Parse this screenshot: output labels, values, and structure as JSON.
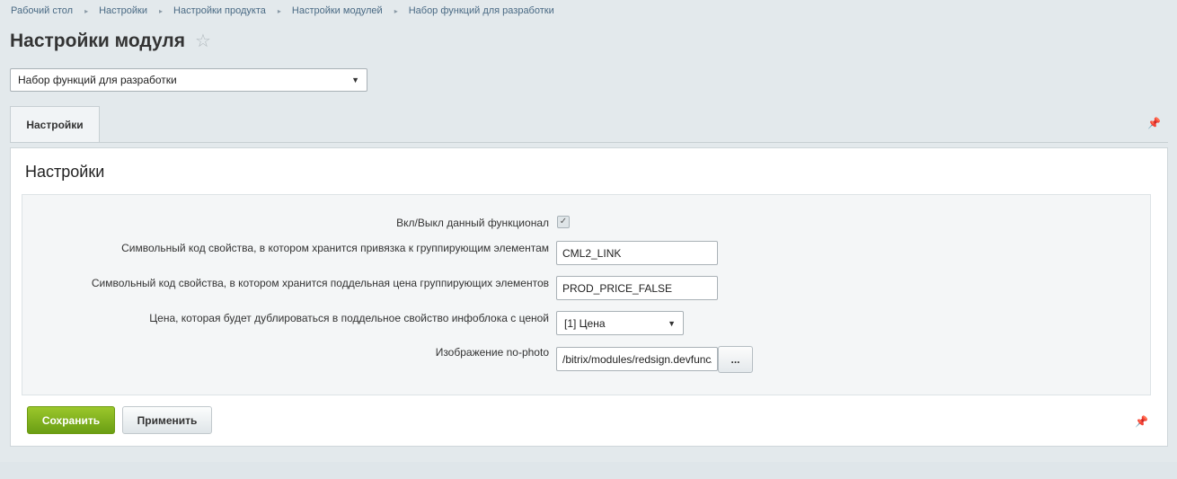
{
  "breadcrumb": {
    "items": [
      "Рабочий стол",
      "Настройки",
      "Настройки продукта",
      "Настройки модулей",
      "Набор функций для разработки"
    ]
  },
  "page": {
    "title": "Настройки модуля"
  },
  "module_select": {
    "value": "Набор функций для разработки"
  },
  "tabs": [
    {
      "label": "Настройки",
      "active": true
    }
  ],
  "panel": {
    "title": "Настройки"
  },
  "form": {
    "enable": {
      "label": "Вкл/Выкл данный функционал",
      "checked": true
    },
    "link_code": {
      "label": "Символьный код свойства, в котором хранится привязка к группирующим элементам",
      "value": "CML2_LINK"
    },
    "price_code": {
      "label": "Символьный код свойства, в котором хранится поддельная цена группирующих элементов",
      "value": "PROD_PRICE_FALSE"
    },
    "price_type": {
      "label": "Цена, которая будет дублироваться в поддельное свойство инфоблока с ценой",
      "value": "[1] Цена"
    },
    "no_photo": {
      "label": "Изображение no-photo",
      "value": "/bitrix/modules/redsign.devfunc/img/no-photo.png",
      "browse_label": "..."
    }
  },
  "actions": {
    "save_label": "Сохранить",
    "apply_label": "Применить"
  },
  "icons": {
    "star": "star-icon",
    "pin": "pin-icon",
    "check": "checkmark-icon",
    "dropdown": "chevron-down-icon"
  },
  "colors": {
    "background": "#e3e9ec",
    "save_button": "#7aab18",
    "link": "#4a6a84"
  }
}
